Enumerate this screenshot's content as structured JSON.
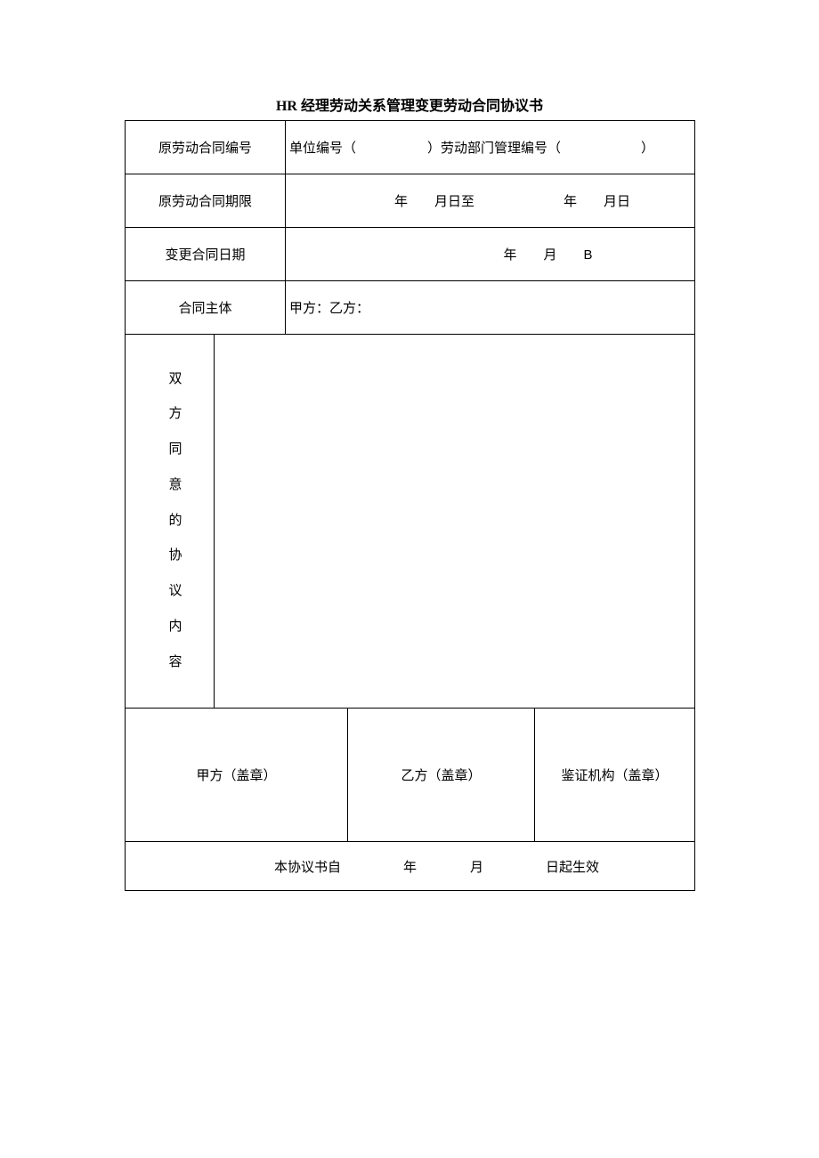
{
  "title": "HR 经理劳动关系管理变更劳动合同协议书",
  "rows": {
    "r1": {
      "label": "原劳动合同编号",
      "seg1": "单位编号（",
      "seg2": "）劳动部门管理编号（",
      "seg3": "）"
    },
    "r2": {
      "label": "原劳动合同期限",
      "y": "年",
      "md": "月日至",
      "y2": "年",
      "md2": "月日"
    },
    "r3": {
      "label": "变更合同日期",
      "y": "年",
      "m": "月",
      "b": "B"
    },
    "r4": {
      "label": "合同主体",
      "value": "甲方：乙方："
    },
    "r5": {
      "label": "双方同意的协议内容"
    },
    "r6": {
      "a": "甲方（盖章）",
      "b": "乙方（盖章）",
      "c": "鉴证机构（盖章）"
    },
    "r7": {
      "pre": "本协议书自",
      "y": "年",
      "m": "月",
      "suf": "日起生效"
    }
  }
}
